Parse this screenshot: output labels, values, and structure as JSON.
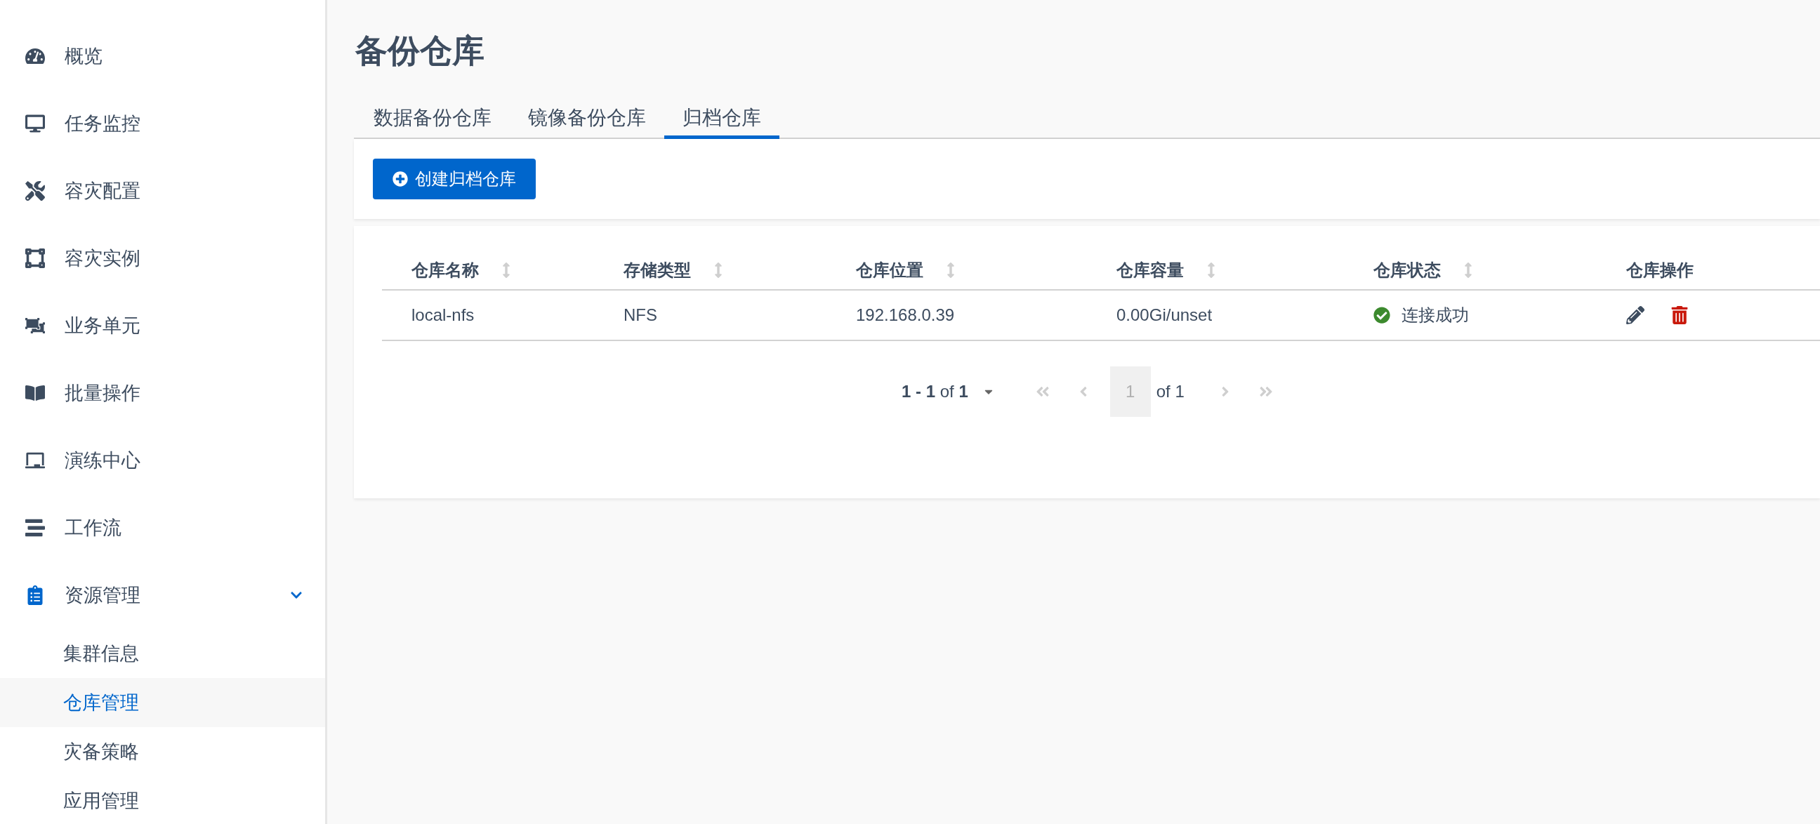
{
  "sidebar": {
    "items": [
      {
        "label": "概览",
        "selected": false
      },
      {
        "label": "任务监控",
        "selected": false
      },
      {
        "label": "容灾配置",
        "selected": false
      },
      {
        "label": "容灾实例",
        "selected": false
      },
      {
        "label": "业务单元",
        "selected": false
      },
      {
        "label": "批量操作",
        "selected": false
      },
      {
        "label": "演练中心",
        "selected": false
      },
      {
        "label": "工作流",
        "selected": false
      },
      {
        "label": "资源管理",
        "selected": true,
        "expanded": true,
        "children": [
          {
            "label": "集群信息",
            "selected": false
          },
          {
            "label": "仓库管理",
            "selected": true
          },
          {
            "label": "灾备策略",
            "selected": false
          },
          {
            "label": "应用管理",
            "selected": false
          }
        ]
      }
    ]
  },
  "page": {
    "title": "备份仓库"
  },
  "tabs": [
    {
      "label": "数据备份仓库",
      "selected": false
    },
    {
      "label": "镜像备份仓库",
      "selected": false
    },
    {
      "label": "归档仓库",
      "selected": true
    }
  ],
  "toolbar": {
    "create_button": "创建归档仓库"
  },
  "table": {
    "columns": [
      {
        "label": "仓库名称",
        "sortable": true
      },
      {
        "label": "存储类型",
        "sortable": true
      },
      {
        "label": "仓库位置",
        "sortable": true
      },
      {
        "label": "仓库容量",
        "sortable": true
      },
      {
        "label": "仓库状态",
        "sortable": true
      },
      {
        "label": "仓库操作",
        "sortable": false
      }
    ],
    "rows": [
      {
        "name": "local-nfs",
        "type": "NFS",
        "location": "192.168.0.39",
        "capacity": "0.00Gi/unset",
        "status": {
          "kind": "success",
          "label": "连接成功"
        }
      }
    ]
  },
  "pagination": {
    "range": "**1 - 1** of **1**",
    "page": "1",
    "of_pages": "of 1",
    "first_disabled": true,
    "prev_disabled": true,
    "next_disabled": true,
    "last_disabled": true
  }
}
